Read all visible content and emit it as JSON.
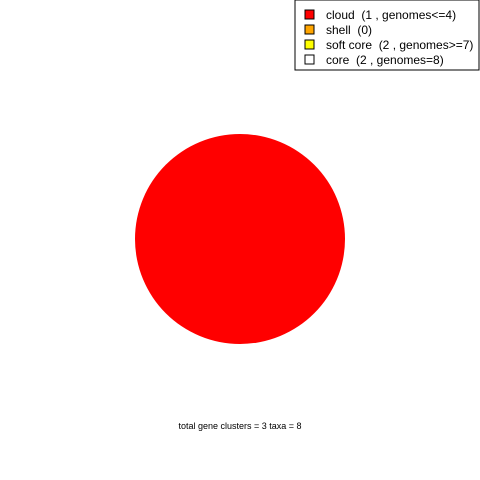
{
  "chart_data": {
    "type": "pie",
    "title": "",
    "caption": "total gene clusters = 3   taxa = 8",
    "legend_position": "top-right",
    "slices": [
      {
        "label": "cloud  (1 , genomes<=4)",
        "value": 1,
        "color": "#ff0000"
      },
      {
        "label": "shell  (0)",
        "value": 0,
        "color": "#ffa500"
      },
      {
        "label": "soft core  (2 , genomes>=7)",
        "value": 2,
        "color": "#ffff00"
      },
      {
        "label": "core  (2 , genomes=8)",
        "value": 2,
        "color": "#ffffff"
      }
    ],
    "drawn_slices": [
      {
        "label": "cloud",
        "value": 1,
        "color": "#ff0000"
      }
    ]
  }
}
